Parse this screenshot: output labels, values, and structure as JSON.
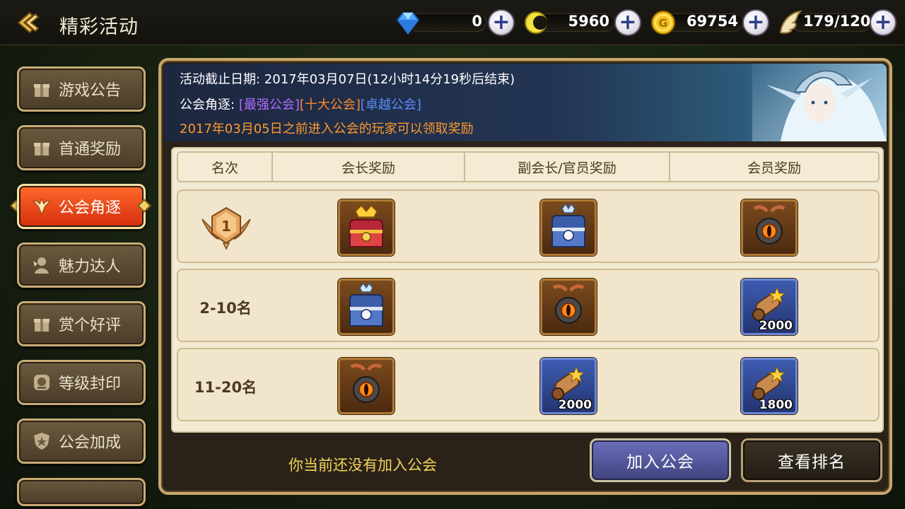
{
  "header": {
    "title": "精彩活动",
    "resources": [
      {
        "icon": "diamond-icon",
        "value": "0"
      },
      {
        "icon": "moon-coin-icon",
        "value": "5960"
      },
      {
        "icon": "gold-coin-icon",
        "value": "69754"
      },
      {
        "icon": "wing-stamina-icon",
        "value": "179/120"
      }
    ],
    "plus_label": "+"
  },
  "sidebar": {
    "items": [
      {
        "label": "游戏公告",
        "icon": "gift-icon"
      },
      {
        "label": "首通奖励",
        "icon": "gift-icon"
      },
      {
        "label": "公会角逐",
        "icon": "wings-emblem-icon",
        "active": true
      },
      {
        "label": "魅力达人",
        "icon": "fairy-icon"
      },
      {
        "label": "赏个好评",
        "icon": "gift-icon"
      },
      {
        "label": "等级封印",
        "icon": "seal-icon"
      },
      {
        "label": "公会加成",
        "icon": "shield-icon"
      }
    ]
  },
  "banner": {
    "deadline": "活动截止日期: 2017年03月07日(12小时14分19秒后结束)",
    "compete_label": "公会角逐:",
    "compete_tags": [
      "[最强公会]",
      "[十大公会]",
      "[卓越公会]"
    ],
    "notice": "2017年03月05日之前进入公会的玩家可以领取奖励"
  },
  "table": {
    "headers": [
      "名次",
      "会长奖励",
      "副会长/官员奖励",
      "会员奖励"
    ],
    "rows": [
      {
        "rank": "1",
        "rewards": [
          {
            "item": "gold-chest-icon",
            "qty": ""
          },
          {
            "item": "silver-chest-icon",
            "qty": ""
          },
          {
            "item": "eye-amulet-icon",
            "qty": ""
          }
        ]
      },
      {
        "rank": "2-10名",
        "rewards": [
          {
            "item": "silver-chest-icon",
            "qty": ""
          },
          {
            "item": "eye-amulet-icon",
            "qty": ""
          },
          {
            "item": "scroll-icon",
            "qty": "2000"
          }
        ]
      },
      {
        "rank": "11-20名",
        "rewards": [
          {
            "item": "eye-amulet-icon",
            "qty": ""
          },
          {
            "item": "scroll-icon",
            "qty": "2000"
          },
          {
            "item": "scroll-icon",
            "qty": "1800"
          }
        ]
      }
    ]
  },
  "footer": {
    "message": "你当前还没有加入公会",
    "join_button": "加入公会",
    "rank_button": "查看排名"
  },
  "colors": {
    "accent_orange": "#e04a14",
    "tag_purple": "#b06cff",
    "tag_orange": "#ff8a2e",
    "tag_blue": "#5d8cff",
    "notice_orange": "#ff9a2c",
    "footer_gold": "#f2d35a"
  }
}
